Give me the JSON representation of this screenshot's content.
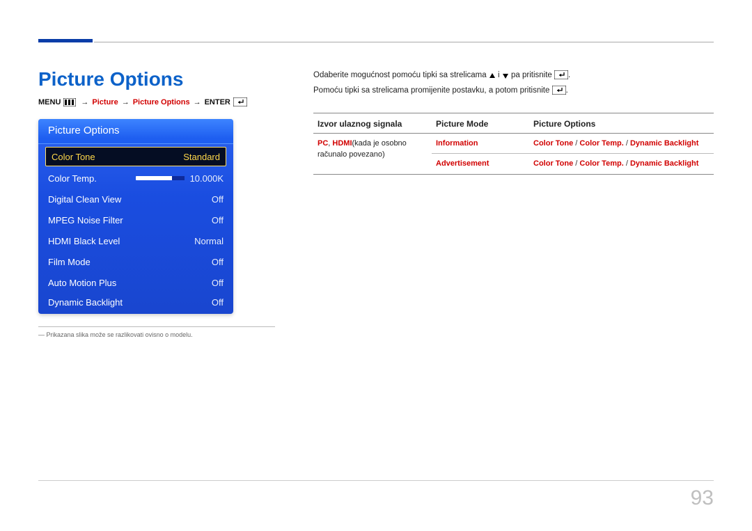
{
  "title": "Picture Options",
  "breadcrumb": {
    "menu": "MENU",
    "picture": "Picture",
    "picture_options": "Picture Options",
    "enter": "ENTER"
  },
  "osd": {
    "header": "Picture Options",
    "rows": [
      {
        "label": "Color Tone",
        "value": "Standard",
        "selected": true
      },
      {
        "label": "Color Temp.",
        "value": "10.000K",
        "slider": true
      },
      {
        "label": "Digital Clean View",
        "value": "Off"
      },
      {
        "label": "MPEG Noise Filter",
        "value": "Off"
      },
      {
        "label": "HDMI Black Level",
        "value": "Normal"
      },
      {
        "label": "Film Mode",
        "value": "Off"
      },
      {
        "label": "Auto Motion Plus",
        "value": "Off"
      },
      {
        "label": "Dynamic Backlight",
        "value": "Off"
      }
    ]
  },
  "footnote": "Prikazana slika može se razlikovati ovisno o modelu.",
  "intro": {
    "line1a": "Odaberite mogućnost pomoću tipki sa strelicama ",
    "line1b": " i ",
    "line1c": " pa pritisnite ",
    "line1d": ".",
    "line2a": "Pomoću tipki sa strelicama promijenite postavku, a potom pritisnite ",
    "line2b": "."
  },
  "table": {
    "headers": {
      "col1": "Izvor ulaznog signala",
      "col2": "Picture Mode",
      "col3": "Picture Options"
    },
    "source": {
      "bold1": "PC",
      "sep": ", ",
      "bold2": "HDMI",
      "rest": "(kada je osobno računalo povezano)"
    },
    "row1": {
      "mode": "Information",
      "opts": {
        "a": "Color Tone",
        "b": "Color Temp.",
        "c": "Dynamic Backlight"
      }
    },
    "row2": {
      "mode": "Advertisement",
      "opts": {
        "a": "Color Tone",
        "b": "Color Temp.",
        "c": "Dynamic Backlight"
      }
    }
  },
  "page_number": "93"
}
